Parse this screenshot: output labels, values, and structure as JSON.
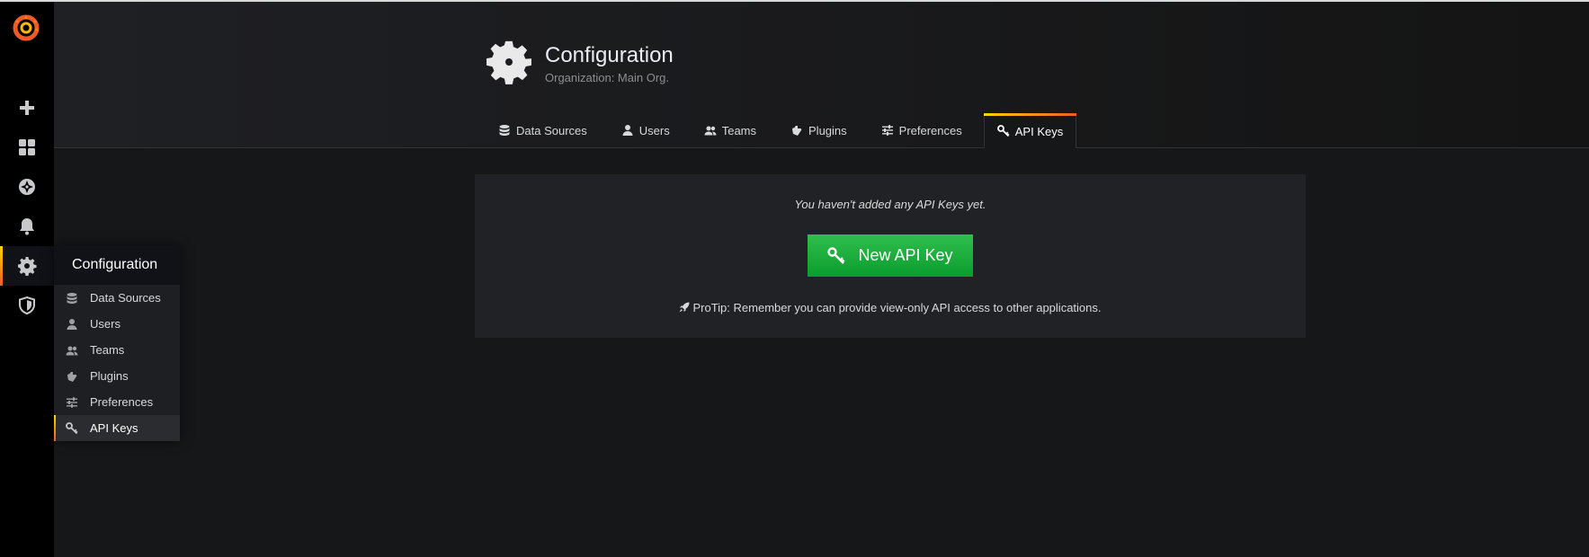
{
  "sidebar": {
    "icons": [
      "grafana-logo-icon",
      "plus-icon",
      "dashboards-icon",
      "explore-icon",
      "bell-icon",
      "gear-icon",
      "shield-icon"
    ],
    "active": "gear-icon"
  },
  "flyout": {
    "title": "Configuration",
    "items": [
      {
        "label": "Data Sources",
        "icon": "database-icon"
      },
      {
        "label": "Users",
        "icon": "user-icon"
      },
      {
        "label": "Teams",
        "icon": "users-icon"
      },
      {
        "label": "Plugins",
        "icon": "plug-icon"
      },
      {
        "label": "Preferences",
        "icon": "sliders-icon"
      },
      {
        "label": "API Keys",
        "icon": "key-icon"
      }
    ],
    "active": "API Keys"
  },
  "header": {
    "title": "Configuration",
    "subtitle": "Organization: Main Org."
  },
  "tabs": [
    {
      "label": "Data Sources",
      "icon": "database-icon"
    },
    {
      "label": "Users",
      "icon": "user-icon"
    },
    {
      "label": "Teams",
      "icon": "users-icon"
    },
    {
      "label": "Plugins",
      "icon": "plug-icon"
    },
    {
      "label": "Preferences",
      "icon": "sliders-icon"
    },
    {
      "label": "API Keys",
      "icon": "key-icon"
    }
  ],
  "active_tab": "API Keys",
  "empty_state": {
    "message": "You haven't added any API Keys yet.",
    "button_label": "New API Key",
    "protip": "ProTip: Remember you can provide view-only API access to other applications."
  },
  "colors": {
    "accent_start": "#ffd500",
    "accent_end": "#f05a28",
    "button_green": "#1aa33d"
  }
}
